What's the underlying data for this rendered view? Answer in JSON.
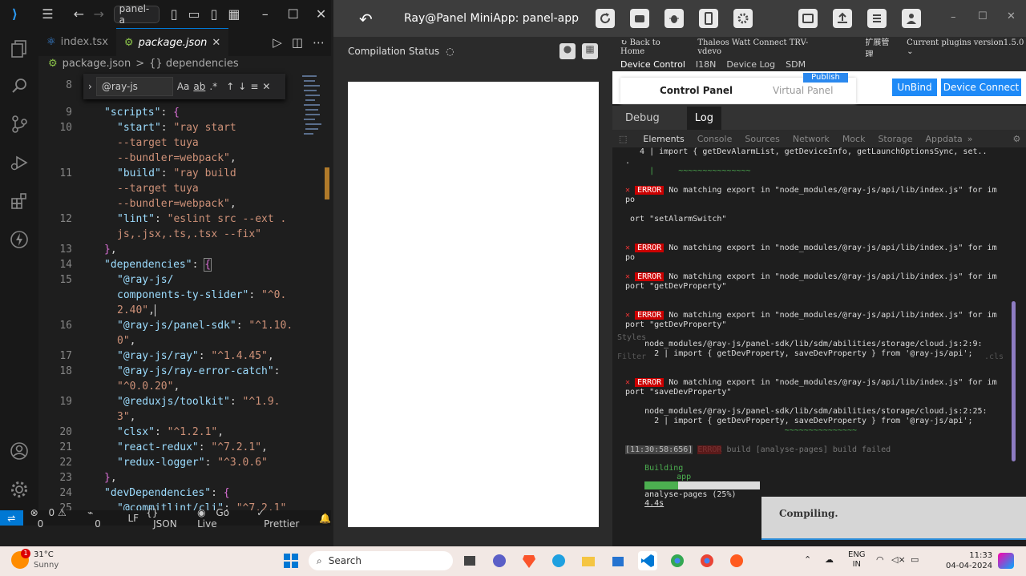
{
  "vscode": {
    "command_center": "panel-a",
    "tabs": [
      {
        "label": "index.tsx"
      },
      {
        "label": "package.json"
      }
    ],
    "breadcrumb": {
      "file": "package.json",
      "sep": ">",
      "node": "{} dependencies"
    },
    "find": {
      "query": "@ray-js",
      "case": "Aa",
      "word": "ab",
      "regex": ".*"
    },
    "lines": [
      "8",
      "9",
      "10",
      "11",
      "12",
      "13",
      "14",
      "15",
      "16",
      "17",
      "18",
      "19",
      "20",
      "21",
      "22",
      "23",
      "24",
      "25"
    ],
    "code": {
      "l9a": "\"scripts\"",
      "l9b": ": ",
      "l10a": "\"start\"",
      "l10b": ": ",
      "l10c": "\"ray start",
      "l10d": "--target tuya",
      "l10e": "--bundler=webpack\"",
      "l11a": "\"build\"",
      "l11c": "\"ray build",
      "l11d": "--target tuya",
      "l11e": "--bundler=webpack\"",
      "l12a": "\"lint\"",
      "l12c": "\"eslint src --ext .",
      "l12d": "js,.jsx,.ts,.tsx --fix\"",
      "l14a": "\"dependencies\"",
      "l15a": "\"@ray-js/",
      "l15b": "components-ty-slider\"",
      "l15c": "\"^0.",
      "l15d": "2.40\"",
      "l16a": "\"@ray-js/panel-sdk\"",
      "l16c": "\"^1.10.",
      "l16d": "0\"",
      "l17a": "\"@ray-js/ray\"",
      "l17c": "\"^1.4.45\"",
      "l18a": "\"@ray-js/ray-error-catch\"",
      "l18d": "\"^0.0.20\"",
      "l19a": "\"@reduxjs/toolkit\"",
      "l19c": "\"^1.9.",
      "l19d": "3\"",
      "l20a": "\"clsx\"",
      "l20c": "\"^1.2.1\"",
      "l21a": "\"react-redux\"",
      "l21c": "\"^7.2.1\"",
      "l22a": "\"redux-logger\"",
      "l22c": "\"^3.0.6\"",
      "l24a": "\"devDependencies\"",
      "l25a": "\"@commitlint/cli\"",
      "l25c": "\"^7.2.1\""
    },
    "status": {
      "errors": "0",
      "warnings": "0",
      "ports": "0",
      "eol": "LF",
      "lang": "JSON",
      "golive": "Go Live",
      "prettier": "Prettier"
    }
  },
  "ide": {
    "title": "Ray@Panel MiniApp:  panel-app",
    "compilation": "Compilation Status",
    "back": "Back to Home",
    "device": "Thaleos Watt Connect TRV-vdevo",
    "ext": "扩展管理",
    "plugins": "Current plugins version1.5.0",
    "tabs": [
      "Device Control",
      "I18N",
      "Device Log",
      "SDM"
    ],
    "publish": "Publish",
    "control_panel": "Control Panel",
    "virtual_panel": "Virtual Panel",
    "unbind": "UnBind",
    "device_connect": "Device Connect",
    "debug": "Debug",
    "log": "Log",
    "devtools": [
      "Elements",
      "Console",
      "Sources",
      "Network",
      "Mock",
      "Storage",
      "Appdata"
    ],
    "console": {
      "l1": "   4 | import { getDevAlarmList, getDeviceInfo, getLaunchOptionsSync, set..",
      "l2": ".",
      "l3": "     |     ~~~~~~~~~~~~~~~",
      "e1": " No matching export in \"node_modules/@ray-js/api/lib/index.js\" for im",
      "e1b": "po",
      "e1c": " ort \"setAlarmSwitch\"",
      "e2": " No matching export in \"node_modules/@ray-js/api/lib/index.js\" for im",
      "e2b": "po",
      "e3": " No matching export in \"node_modules/@ray-js/api/lib/index.js\" for im",
      "e3b": "port \"getDevProperty\"",
      "e4": " No matching export in \"node_modules/@ray-js/api/lib/index.js\" for im",
      "e4b": "port \"getDevProperty\"",
      "styles": "Styles",
      "p1": "    node_modules/@ray-js/panel-sdk/lib/sdm/abilities/storage/cloud.js:2:9:",
      "p2": "      2 | import { getDevProperty, saveDevProperty } from '@ray-js/api';",
      "filter": "Filter",
      "cls": ".cls",
      "e5": " No matching export in \"node_modules/@ray-js/api/lib/index.js\" for im",
      "e5b": "port \"saveDevProperty\"",
      "p3": "    node_modules/@ray-js/panel-sdk/lib/sdm/abilities/storage/cloud.js:2:25:",
      "p4": "      2 | import { getDevProperty, saveDevProperty } from '@ray-js/api';",
      "p5": "                                 ~~~~~~~~~~~~~~~",
      "ts": "[11:30:58:656]",
      "build": " build [analyse-pages] build failed",
      "building": "Building",
      "app": "app",
      "pct": "analyse-pages (25%)",
      "time": "4.4s",
      "error_badge": "ERROR"
    },
    "toast": "Compiling."
  },
  "taskbar": {
    "temp": "31°C",
    "weather": "Sunny",
    "search": "Search",
    "lang1": "ENG",
    "lang2": "IN",
    "time": "11:33",
    "date": "04-04-2024",
    "badge": "1"
  }
}
